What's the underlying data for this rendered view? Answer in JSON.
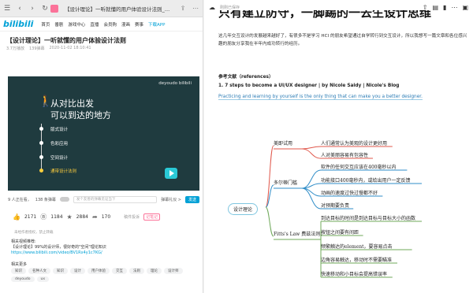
{
  "browser": {
    "tab_title": "【设计理论】一听就懂的用户体验设计法则_哔哩哔哩 (...",
    "nav": [
      "首页",
      "番剧",
      "游戏中心",
      "直播",
      "会员购",
      "漫画",
      "赛事",
      "下载APP"
    ],
    "logo": "bilibili"
  },
  "video": {
    "title": "【设计理论】一听就懂的用户体验设计法则",
    "views": "3.7万播放",
    "danmaku": "139弹幕",
    "date": "2020-11-02 18:10:41",
    "brand": "deyoudo bilibili",
    "slide_title1": "从对比出发",
    "slide_title2": "可以到达的地方",
    "steps": [
      "版式设计",
      "色彩应用",
      "空间设计",
      "通带设计法则"
    ],
    "active_step": 3,
    "viewers": "9 人正在看，",
    "dm_count": "138 条弹幕",
    "dm_placeholder": "发个友善的弹幕见证当下",
    "dm_etiquette": "弹幕礼仪 >",
    "send_label": "发送",
    "likes": "2171",
    "coins": "1184",
    "favs": "2884",
    "shares": "170",
    "report": "稿件投诉",
    "share_badge": "记笔记",
    "notice": "未经作者授权，禁止转载",
    "desc_title": "相关视频推荐:",
    "desc_line1": "【设计理论】99%的设计师，很好奇的\"空间\"理论知识",
    "desc_link": "https://www.bilibili.com/video/BV1Rx4y1c7KG/",
    "tags_title": "相关更多",
    "tags": [
      "知识",
      "名种人文",
      "知识",
      "设计",
      "用户体验",
      "交互",
      "法则",
      "理论",
      "设计师",
      "deyoudo",
      "ux"
    ]
  },
  "notes": {
    "status": "刚刚已保存",
    "heading": "只有建立防守，一脚踢的一去生设计思维",
    "paragraph": "这几年交互设计的发展越来越好了，有很多不是学习 HCI 的朋友希望通过自学转行到交互设计，所以我想写一篇文章和各位感兴趣的朋友分享我在半年内成功转行的经历。",
    "ref_head": "参考文献（references）",
    "ref_title": "1. 7 steps to become a UI/UX designer | by Nicole Saidy | Nicole's Blog",
    "ref_quote": "Practicing and learning by yourself is the only thing that can make you a better designer."
  },
  "mindmap": {
    "root": "设计理论",
    "branches": [
      {
        "label": "美即试用",
        "children": [
          "人们通常认为美观的设计更好用",
          "人对美丽容易有包容性"
        ]
      },
      {
        "label": "多尔蒂门槛",
        "children": [
          "软件的任何交互应该在400毫秒以内",
          "功能接口400毫秒内，或给出用户一定反馈",
          "动画的速度过快过慢都不好",
          "对预期要负责"
        ]
      },
      {
        "label": "Fitts's Law 费兹法则：",
        "children": [
          "到达目标的时间是到达目标与目标大小的函数",
          "按钮之间要有间距",
          "频繁触达的element，要容易点击",
          "边角容易触达，移动时不需要瞄准",
          "快速移动和小目标会提高错误率"
        ]
      }
    ],
    "colors": {
      "root": "#7fc6e0",
      "b1": "#e0574b",
      "b2": "#2f8dc8",
      "b3": "#6fa85a"
    }
  }
}
